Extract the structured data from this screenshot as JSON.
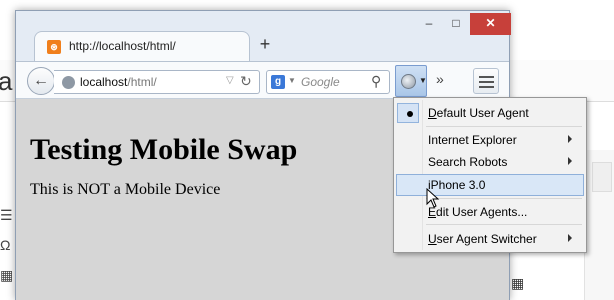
{
  "background": {
    "partial_letter": "a"
  },
  "window": {
    "titlebar": {
      "minimize_glyph": "–",
      "maximize_glyph": "□",
      "close_glyph": "✕"
    },
    "tab": {
      "title": "http://localhost/html/",
      "new_tab_glyph": "+"
    },
    "navbar": {
      "back_glyph": "←",
      "url_host": "localhost",
      "url_path": "/html/",
      "search_engine_letter": "g",
      "search_placeholder": "Google",
      "overflow_glyph": "»"
    },
    "page": {
      "heading": "Testing Mobile Swap",
      "paragraph": "This is NOT a Mobile Device"
    }
  },
  "user_agent_menu": {
    "items": [
      {
        "first": "D",
        "rest": "efault User Agent",
        "checked": true,
        "submenu": false
      },
      {
        "label": "Internet Explorer",
        "submenu": true
      },
      {
        "label": "Search Robots",
        "submenu": true
      },
      {
        "label": "iPhone 3.0",
        "submenu": false,
        "hover": true
      },
      {
        "first": "E",
        "rest": "dit User Agents...",
        "submenu": false
      },
      {
        "first": "U",
        "rest": "ser Agent Switcher",
        "submenu": true
      }
    ]
  },
  "colors": {
    "close_button": "#c7403a",
    "page_background": "#d6d6d6",
    "menu_hover": "#d9e7f7",
    "favicon": "#f07f1c"
  }
}
